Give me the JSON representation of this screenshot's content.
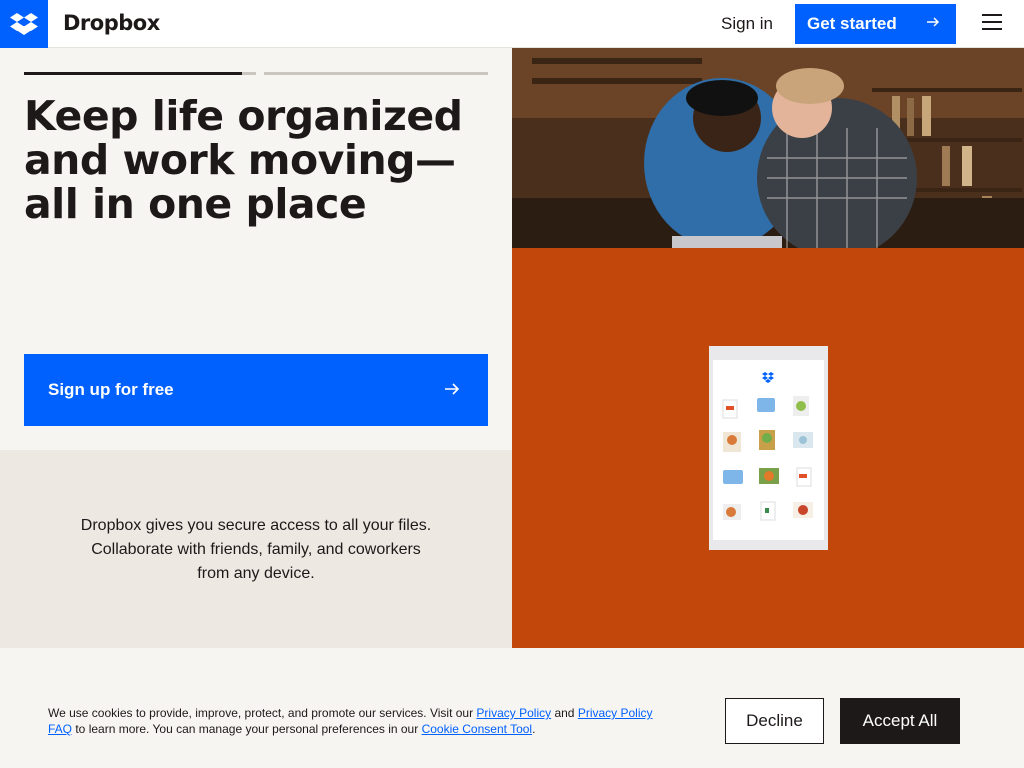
{
  "header": {
    "brand": "Dropbox",
    "sign_in": "Sign in",
    "get_started": "Get started",
    "icons": [
      "dropbox-logo-icon",
      "arrow-right-icon",
      "hamburger-menu-icon"
    ]
  },
  "hero": {
    "slide_progress": [
      1.0,
      0.0
    ],
    "headline_lines": [
      "Keep life organized",
      "and work moving—",
      "all in one place"
    ],
    "signup_label": "Sign up for free",
    "description_lines": [
      "Dropbox gives you secure access to all your files.",
      "Collaborate with friends, family, and coworkers",
      "from any device."
    ]
  },
  "colors": {
    "brand_blue": "#0061fe",
    "accent_orange": "#c2470b",
    "ink": "#1e1919",
    "background": "#f7f5f2",
    "panel": "#ede8e2"
  },
  "cookie": {
    "text_1": "We use cookies to provide, improve, protect, and promote our services. Visit our ",
    "privacy_link": "Privacy Policy",
    "text_2": " and ",
    "faq_link": "Privacy Policy FAQ",
    "text_3": " to learn more. You can manage your personal preferences in our ",
    "consent_link": "Cookie Consent Tool",
    "text_4": ".",
    "decline": "Decline",
    "accept": "Accept All"
  }
}
